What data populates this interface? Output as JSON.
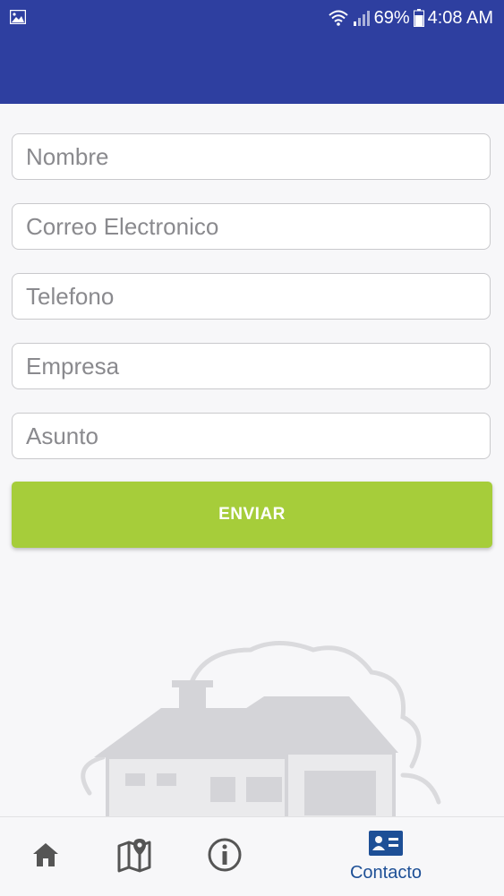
{
  "status_bar": {
    "battery_percent": "69%",
    "time": "4:08 AM",
    "icons": [
      "image-icon",
      "wifi-icon",
      "signal-icon",
      "battery-icon"
    ]
  },
  "form": {
    "fields": [
      {
        "placeholder": "Nombre",
        "value": ""
      },
      {
        "placeholder": "Correo Electronico",
        "value": ""
      },
      {
        "placeholder": "Telefono",
        "value": ""
      },
      {
        "placeholder": "Empresa",
        "value": ""
      },
      {
        "placeholder": "Asunto",
        "value": ""
      }
    ],
    "submit_label": "ENVIAR"
  },
  "bottom_nav": {
    "items": [
      {
        "icon": "home-icon",
        "label": ""
      },
      {
        "icon": "map-icon",
        "label": ""
      },
      {
        "icon": "info-icon",
        "label": ""
      },
      {
        "icon": "contact-card-icon",
        "label": "Contacto",
        "active": true
      }
    ]
  },
  "colors": {
    "app_bar": "#2e3fa0",
    "submit_button": "#a6cd3a",
    "active_nav": "#1d4f96",
    "inactive_nav": "#555555"
  }
}
